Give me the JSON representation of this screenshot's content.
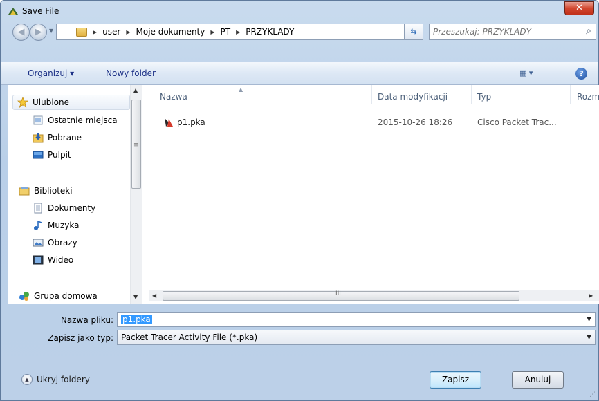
{
  "window": {
    "title": "Save File",
    "close_label": "✕"
  },
  "address_bar": {
    "crumbs": [
      "user",
      "Moje dokumenty",
      "PT",
      "PRZYKLADY"
    ]
  },
  "search": {
    "placeholder": "Przeszukaj: PRZYKLADY"
  },
  "toolbar": {
    "organize_label": "Organizuj ▾",
    "new_folder_label": "Nowy folder",
    "view_label": "▦ ▾",
    "help_label": "?"
  },
  "nav_pane": {
    "items": [
      {
        "label": "Ulubione",
        "icon": "star-icon"
      },
      {
        "label": "Ostatnie miejsca",
        "icon": "recent-places-icon"
      },
      {
        "label": "Pobrane",
        "icon": "downloads-icon"
      },
      {
        "label": "Pulpit",
        "icon": "desktop-icon"
      },
      {
        "label": "Biblioteki",
        "icon": "libraries-icon"
      },
      {
        "label": "Dokumenty",
        "icon": "documents-icon"
      },
      {
        "label": "Muzyka",
        "icon": "music-icon"
      },
      {
        "label": "Obrazy",
        "icon": "pictures-icon"
      },
      {
        "label": "Wideo",
        "icon": "video-icon"
      },
      {
        "label": "Grupa domowa",
        "icon": "homegroup-icon"
      }
    ]
  },
  "file_list": {
    "columns": [
      "Nazwa",
      "Data modyfikacji",
      "Typ",
      "Rozm"
    ],
    "rows": [
      {
        "name": "p1.pka",
        "modified": "2015-10-26 18:26",
        "type": "Cisco Packet Trac..."
      }
    ],
    "hscroll_grip": "III"
  },
  "form": {
    "filename_label": "Nazwa pliku:",
    "filename_value": "p1.pka",
    "filetype_label": "Zapisz jako typ:",
    "filetype_value": "Packet Tracer Activity File (*.pka)"
  },
  "footer": {
    "hide_folders_label": "Ukryj foldery",
    "save_label": "Zapisz",
    "cancel_label": "Anuluj"
  },
  "colors": {
    "accent": "#3399ff",
    "link_text": "#1e3287"
  }
}
